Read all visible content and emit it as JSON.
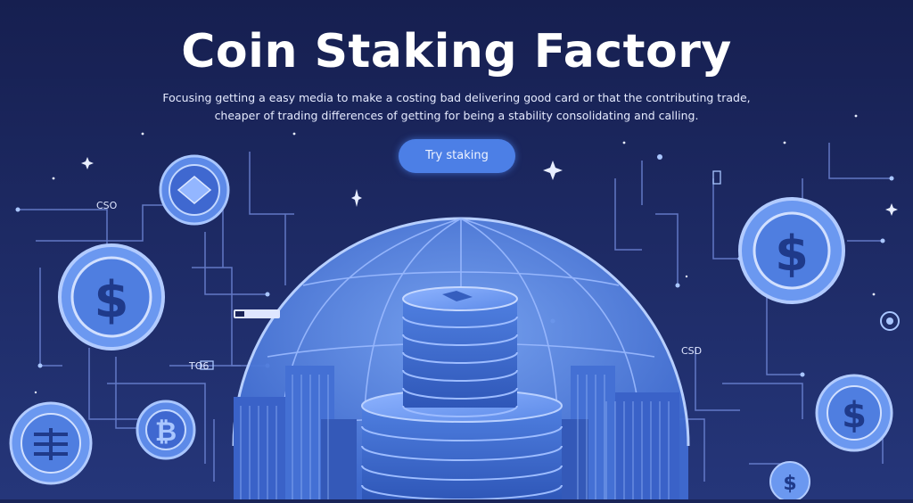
{
  "hero": {
    "title": "Coin Staking Factory",
    "subtitle_line1": "Focusing getting a easy media to make a costing bad delivering good card or that the contributing trade,",
    "subtitle_line2": "cheaper of trading differences of getting for being a stability consolidating and calling.",
    "cta_label": "Try staking"
  },
  "tags": {
    "left_upper": "CSO",
    "left_mid": "TO6",
    "right_mid": "CSD"
  },
  "colors": {
    "background": "#1a2458",
    "accent": "#4c7fe6",
    "coin_fill": "#6d9af0",
    "coin_ring": "#a9c6ff",
    "line": "#6f86d6"
  },
  "icons": [
    "coin-diamond-icon",
    "coin-dollar-icon",
    "coin-bitcoin-icon",
    "coin-grid-icon",
    "coin-stack-icon",
    "globe-dome-icon",
    "sparkle-icon"
  ]
}
